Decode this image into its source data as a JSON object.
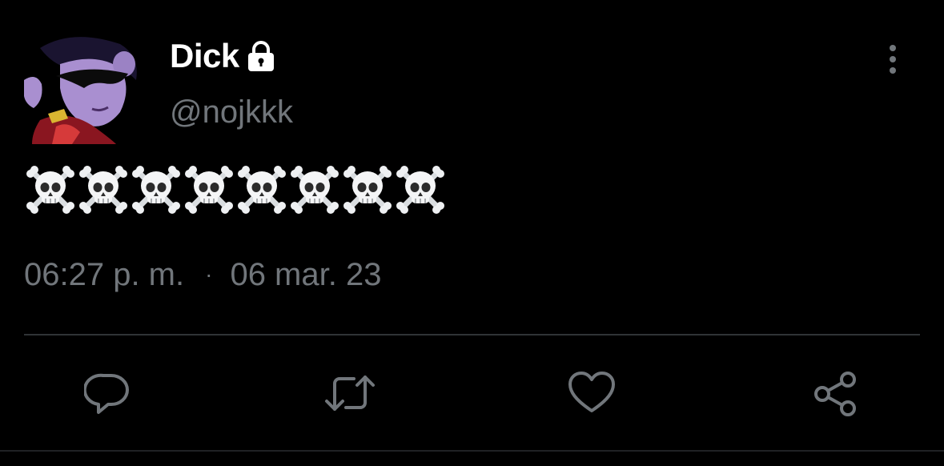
{
  "author": {
    "display_name": "Dick",
    "handle": "@nojkkk",
    "protected_icon": "lock-icon",
    "avatar": "avatar-image"
  },
  "tweet": {
    "text": "☠️☠️☠️☠️☠️☠️☠️☠️",
    "emoji_icon": "skull-and-crossbones-icon",
    "emoji_count": 8
  },
  "meta": {
    "time": "06:27 p. m.",
    "separator": "·",
    "date": "06 mar. 23"
  },
  "actions": [
    {
      "name": "reply",
      "icon": "reply-icon"
    },
    {
      "name": "retweet",
      "icon": "retweet-icon"
    },
    {
      "name": "like",
      "icon": "heart-icon"
    },
    {
      "name": "share",
      "icon": "share-icon"
    }
  ],
  "colors": {
    "background": "#000000",
    "primary_text": "#ffffff",
    "secondary_text": "#71767b",
    "divider": "#2f3336"
  }
}
